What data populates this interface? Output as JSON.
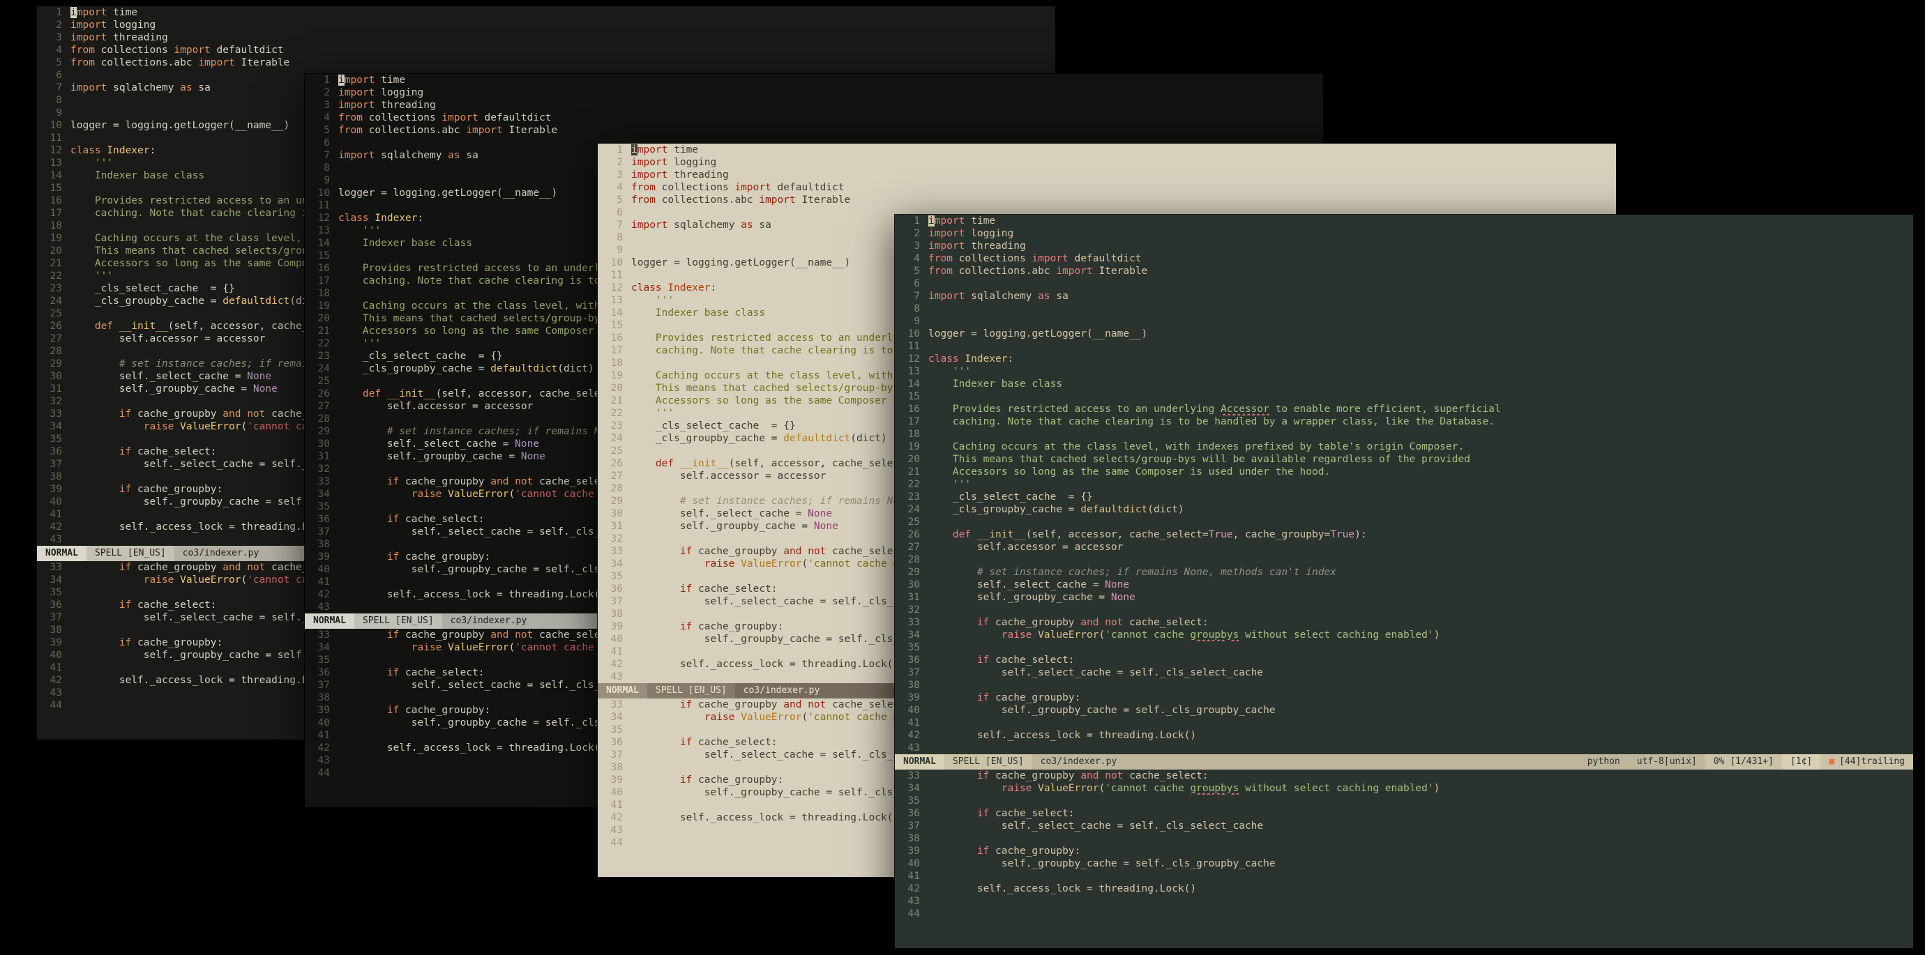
{
  "desktop": {
    "background": "#000000"
  },
  "file": "co3/indexer.py",
  "cursor": {
    "line": 1,
    "col": 1
  },
  "statusline": {
    "mode": "NORMAL",
    "spell": "SPELL [EN_US]",
    "filename": "co3/indexer.py",
    "filetype": "python",
    "encoding": "utf-8[unix]",
    "position": "0% [1/431+]",
    "column": "[1¢]",
    "trailing_icon": "■",
    "trailing": "[44]trailing"
  },
  "splits": {
    "top": {
      "first_line": 1,
      "last_line": 43
    },
    "bottom": {
      "first_line": 33,
      "last_line": 44
    }
  },
  "windows": [
    {
      "id": "editor-window-1",
      "theme": "warm_dark"
    },
    {
      "id": "editor-window-2",
      "theme": "near_black"
    },
    {
      "id": "editor-window-3",
      "theme": "cream_light"
    },
    {
      "id": "editor-window-4",
      "theme": "everforest_dark"
    }
  ],
  "themes": {
    "warm_dark": {
      "bg": "#1a1a18",
      "fg": "#d6d2c4",
      "lnr": "#6b6458",
      "kw": "#de935f",
      "doc": "#9aab6e",
      "str": "#cc6666",
      "com": "#8f8b7e",
      "cst": "#b294bb",
      "fn": "#f0c674",
      "cls": "#f0c674",
      "spl": "#e06c60",
      "barbg": "#b3afa3",
      "barfg": "#23211c",
      "chip": "#dcd8cc",
      "chip2": "#c5c1b5",
      "warnc": "#d7703f"
    },
    "near_black": {
      "bg": "#121210",
      "fg": "#cfcabc",
      "lnr": "#5f5a50",
      "kw": "#e08a55",
      "doc": "#95a765",
      "str": "#c96060",
      "com": "#87836f",
      "cst": "#ad8fbd",
      "fn": "#e8c06a",
      "cls": "#e8c06a",
      "spl": "#e06c60",
      "barbg": "#adada5",
      "barfg": "#1f1e1a",
      "chip": "#d6d6ce",
      "chip2": "#c0c0b8",
      "warnc": "#d7703f"
    },
    "cream_light": {
      "bg": "#d7d0bd",
      "fg": "#423c33",
      "lnr": "#a29680",
      "kw": "#9d2007",
      "doc": "#72741c",
      "str": "#7c6f1a",
      "com": "#968c77",
      "cst": "#8f3f71",
      "fn": "#b57614",
      "cls": "#af3a03",
      "spl": "#c14a4a",
      "barbg": "#766a5d",
      "barfg": "#eee4cb",
      "chip": "#998d7c",
      "chip2": "#857a6b",
      "warnc": "#e5703f"
    },
    "everforest_dark": {
      "bg": "#2b332f",
      "fg": "#d3c6aa",
      "lnr": "#7f8777",
      "kw": "#e67e80",
      "doc": "#a7c080",
      "str": "#a7c080",
      "com": "#8b9286",
      "cst": "#d699b6",
      "fn": "#dbbc7f",
      "cls": "#dbbc7f",
      "spl": "#e67e80",
      "barbg": "#beb69c",
      "barfg": "#2b332f",
      "chip": "#d8d0b4",
      "chip2": "#cbc3a8",
      "warnc": "#e67640"
    }
  },
  "code": [
    [
      [
        "kw",
        "import"
      ],
      [
        "pl",
        " time"
      ]
    ],
    [
      [
        "kw",
        "import"
      ],
      [
        "pl",
        " logging"
      ]
    ],
    [
      [
        "kw",
        "import"
      ],
      [
        "pl",
        " threading"
      ]
    ],
    [
      [
        "kw",
        "from"
      ],
      [
        "pl",
        " collections "
      ],
      [
        "kw",
        "import"
      ],
      [
        "pl",
        " defaultdict"
      ]
    ],
    [
      [
        "kw",
        "from"
      ],
      [
        "pl",
        " collections.abc "
      ],
      [
        "kw",
        "import"
      ],
      [
        "pl",
        " Iterable"
      ]
    ],
    [],
    [
      [
        "kw",
        "import"
      ],
      [
        "pl",
        " sqlalchemy "
      ],
      [
        "kw",
        "as"
      ],
      [
        "pl",
        " sa"
      ]
    ],
    [],
    [],
    [
      [
        "pl",
        "logger = logging.getLogger(__name__)"
      ]
    ],
    [],
    [
      [
        "kw",
        "class"
      ],
      [
        "pl",
        " "
      ],
      [
        "cls",
        "Indexer"
      ],
      [
        "pl",
        ":"
      ]
    ],
    [
      [
        "doc",
        "    '''"
      ]
    ],
    [
      [
        "doc",
        "    Indexer base class"
      ]
    ],
    [],
    [
      [
        "doc",
        "    Provides restricted access to an underlying "
      ],
      [
        "docsp",
        "Accessor"
      ],
      [
        "doc",
        " to enable more efficient, superficial"
      ]
    ],
    [
      [
        "doc",
        "    caching. Note that cache clearing is to be handled by a wrapper class, like the Database."
      ]
    ],
    [],
    [
      [
        "doc",
        "    Caching occurs at the class level, with indexes prefixed by table's origin Composer."
      ]
    ],
    [
      [
        "doc",
        "    This means that cached selects/group-bys will be available regardless of the provided"
      ]
    ],
    [
      [
        "doc",
        "    Accessors so long as the same Composer is used under the hood."
      ]
    ],
    [
      [
        "doc",
        "    '''"
      ]
    ],
    [
      [
        "pl",
        "    _cls_select_cache  = {}"
      ]
    ],
    [
      [
        "pl",
        "    _cls_groupby_cache = "
      ],
      [
        "fn",
        "defaultdict"
      ],
      [
        "pl",
        "(dict)"
      ]
    ],
    [],
    [
      [
        "pl",
        "    "
      ],
      [
        "kw",
        "def"
      ],
      [
        "pl",
        " "
      ],
      [
        "fn",
        "__init__"
      ],
      [
        "pl",
        "(self, accessor, cache_select="
      ],
      [
        "cst",
        "True"
      ],
      [
        "pl",
        ", cache_groupby="
      ],
      [
        "cst",
        "True"
      ],
      [
        "pl",
        "):"
      ]
    ],
    [
      [
        "pl",
        "        self.accessor = accessor"
      ]
    ],
    [],
    [
      [
        "com",
        "        # set instance caches; if remains None, methods can't index"
      ]
    ],
    [
      [
        "pl",
        "        self._select_cache = "
      ],
      [
        "cst",
        "None"
      ]
    ],
    [
      [
        "pl",
        "        self._groupby_cache = "
      ],
      [
        "cst",
        "None"
      ]
    ],
    [],
    [
      [
        "pl",
        "        "
      ],
      [
        "kw",
        "if"
      ],
      [
        "pl",
        " cache_groupby "
      ],
      [
        "kw",
        "and"
      ],
      [
        "pl",
        " "
      ],
      [
        "kw",
        "not"
      ],
      [
        "pl",
        " cache_select:"
      ]
    ],
    [
      [
        "pl",
        "            "
      ],
      [
        "kw",
        "raise"
      ],
      [
        "pl",
        " "
      ],
      [
        "fn",
        "ValueError"
      ],
      [
        "pl",
        "("
      ],
      [
        "str",
        "'cannot cache "
      ],
      [
        "strsp",
        "groupbys"
      ],
      [
        "str",
        " without select caching enabled'"
      ],
      [
        "pl",
        ")"
      ]
    ],
    [],
    [
      [
        "pl",
        "        "
      ],
      [
        "kw",
        "if"
      ],
      [
        "pl",
        " cache_select:"
      ]
    ],
    [
      [
        "pl",
        "            self._select_cache = self._cls_select_cache"
      ]
    ],
    [],
    [
      [
        "pl",
        "        "
      ],
      [
        "kw",
        "if"
      ],
      [
        "pl",
        " cache_groupby:"
      ]
    ],
    [
      [
        "pl",
        "            self._groupby_cache = self._cls_groupby_cache"
      ]
    ],
    [],
    [
      [
        "pl",
        "        self._access_lock = threading.Lock()"
      ]
    ],
    [],
    []
  ]
}
